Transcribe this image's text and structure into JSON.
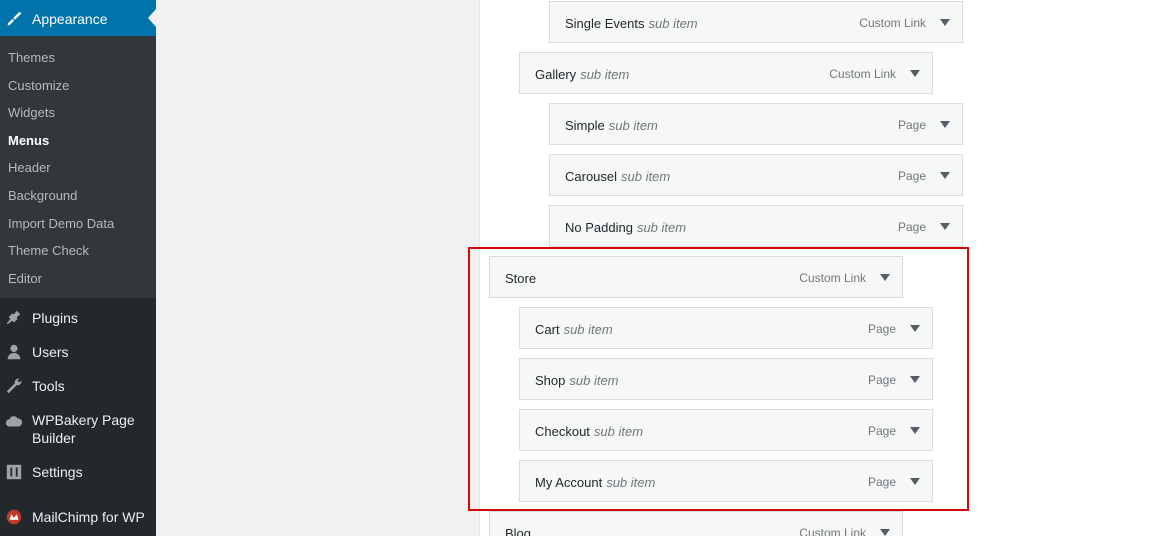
{
  "sidebar": {
    "active": {
      "label": "Appearance",
      "icon": "paintbrush-icon"
    },
    "submenu": [
      {
        "label": "Themes"
      },
      {
        "label": "Customize"
      },
      {
        "label": "Widgets"
      },
      {
        "label": "Menus",
        "current": true
      },
      {
        "label": "Header"
      },
      {
        "label": "Background"
      },
      {
        "label": "Import Demo Data"
      },
      {
        "label": "Theme Check"
      },
      {
        "label": "Editor"
      }
    ],
    "items": [
      {
        "label": "Plugins",
        "icon": "plugin-icon"
      },
      {
        "label": "Users",
        "icon": "user-icon"
      },
      {
        "label": "Tools",
        "icon": "wrench-icon"
      },
      {
        "label": "WPBakery Page Builder",
        "icon": "cloud-icon"
      },
      {
        "label": "Settings",
        "icon": "settings-icon"
      },
      {
        "label": "MailChimp for WP",
        "icon": "mailchimp-icon"
      }
    ]
  },
  "menu_items": [
    {
      "title": "Single Events",
      "sub": "sub item",
      "type": "Custom Link"
    },
    {
      "title": "Gallery",
      "sub": "sub item",
      "type": "Custom Link"
    },
    {
      "title": "Simple",
      "sub": "sub item",
      "type": "Page"
    },
    {
      "title": "Carousel",
      "sub": "sub item",
      "type": "Page"
    },
    {
      "title": "No Padding",
      "sub": "sub item",
      "type": "Page"
    },
    {
      "title": "Store",
      "sub": "",
      "type": "Custom Link"
    },
    {
      "title": "Cart",
      "sub": "sub item",
      "type": "Page"
    },
    {
      "title": "Shop",
      "sub": "sub item",
      "type": "Page"
    },
    {
      "title": "Checkout",
      "sub": "sub item",
      "type": "Page"
    },
    {
      "title": "My Account",
      "sub": "sub item",
      "type": "Page"
    },
    {
      "title": "Blog",
      "sub": "",
      "type": "Custom Link"
    }
  ],
  "colors": {
    "admin_blue": "#0073aa",
    "highlight_red": "#d10a0a",
    "sidebar_bg": "#23282d"
  }
}
